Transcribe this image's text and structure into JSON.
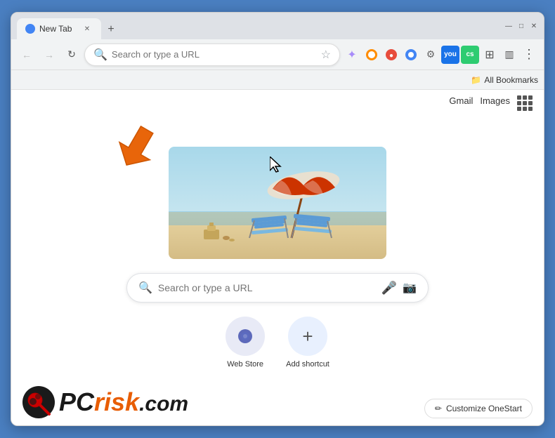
{
  "browser": {
    "tab_label": "New Tab",
    "address_placeholder": "Search or type a URL",
    "address_value": "Search or type a URL"
  },
  "toolbar": {
    "back_label": "←",
    "forward_label": "→",
    "reload_label": "↻",
    "bookmarks_label": "All Bookmarks"
  },
  "top_links": {
    "gmail": "Gmail",
    "images": "Images"
  },
  "search": {
    "placeholder": "Search or type a URL",
    "value": ""
  },
  "shortcuts": [
    {
      "id": "web-store",
      "label": "Web Store",
      "icon": "🌐"
    },
    {
      "id": "add-shortcut",
      "label": "Add shortcut",
      "icon": "+"
    }
  ],
  "watermark": {
    "site": "PCrisk.com",
    "pc_part": "PC",
    "risk_part": "risk",
    "com_part": ".com"
  },
  "customize_btn": {
    "label": "Customize OneStart",
    "icon": "✏"
  },
  "window_controls": {
    "minimize": "—",
    "maximize": "□",
    "close": "✕"
  }
}
